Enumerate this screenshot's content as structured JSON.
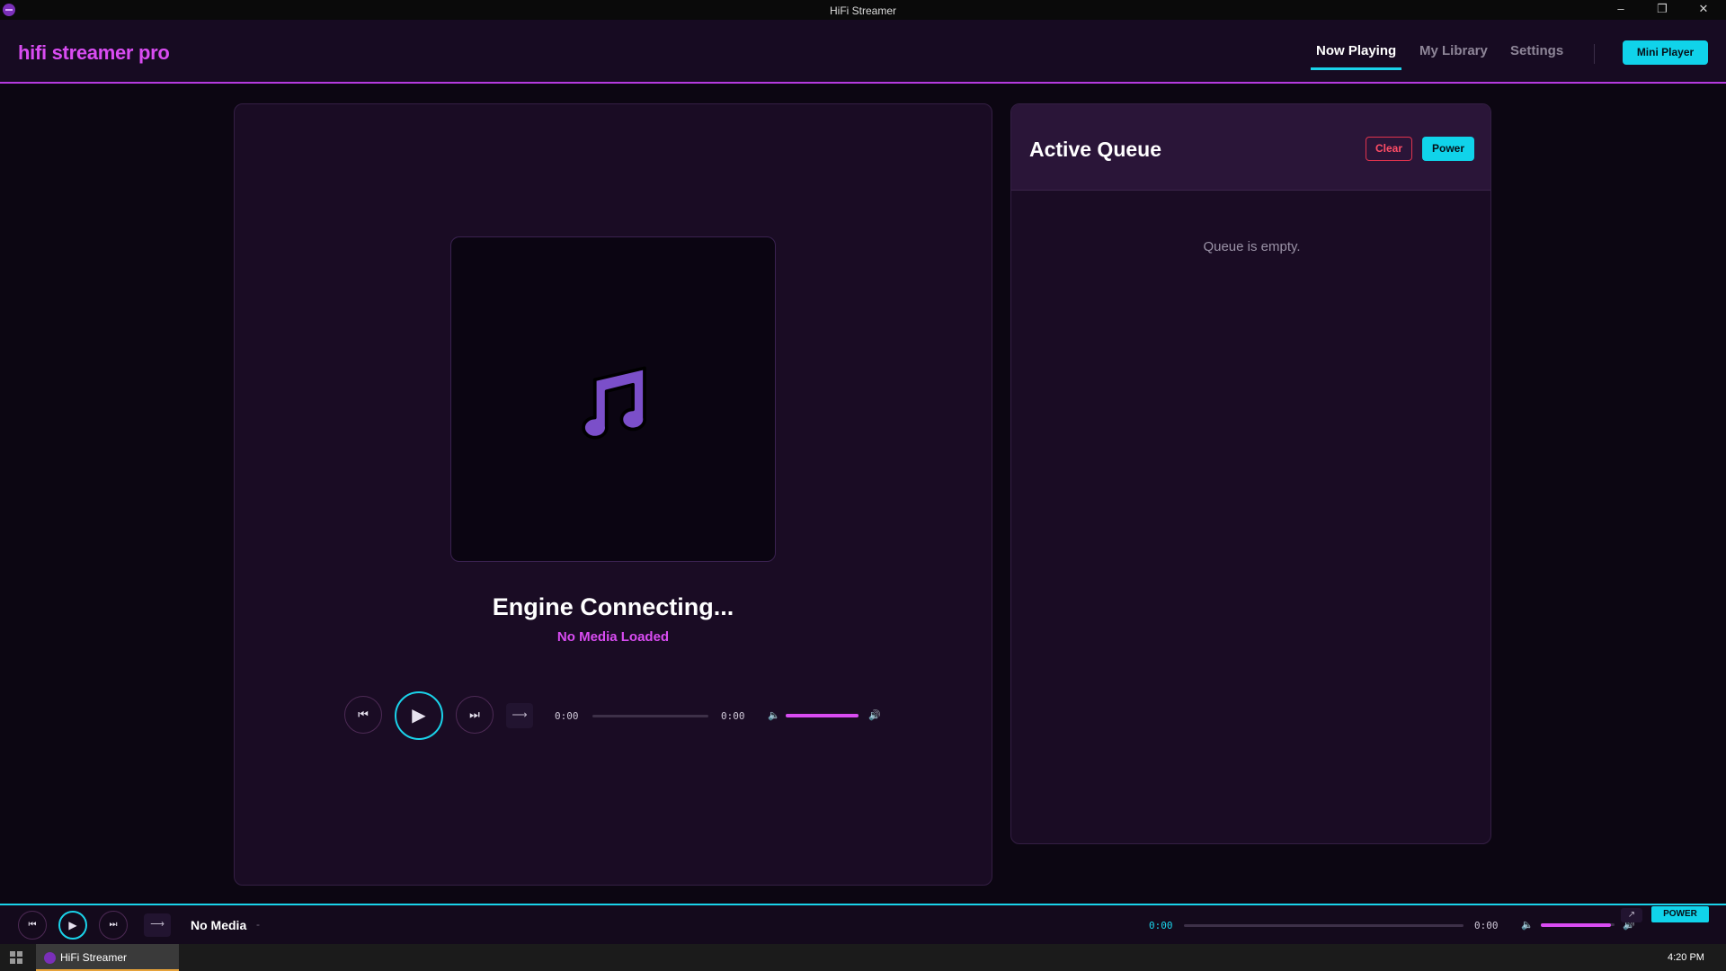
{
  "window": {
    "title": "HiFi Streamer",
    "minimize_glyph": "–",
    "restore_glyph": "❐",
    "close_glyph": "✕"
  },
  "header": {
    "brand": "hifi streamer pro",
    "tabs": [
      {
        "label": "Now Playing",
        "active": true
      },
      {
        "label": "My Library",
        "active": false
      },
      {
        "label": "Settings",
        "active": false
      }
    ],
    "mini_player_label": "Mini Player"
  },
  "now_playing": {
    "title": "Engine Connecting...",
    "subtitle": "No Media Loaded",
    "elapsed": "0:00",
    "duration": "0:00",
    "progress": 0,
    "volume": 1.0,
    "icons": {
      "prev": "skip-previous-icon",
      "play": "play-icon",
      "next": "skip-next-icon",
      "repeat": "repeat-icon",
      "art": "music-note-icon"
    }
  },
  "queue": {
    "title": "Active Queue",
    "clear_label": "Clear",
    "power_label": "Power",
    "empty_text": "Queue is empty."
  },
  "bottom_bar": {
    "title": "No Media",
    "separator": "-",
    "elapsed": "0:00",
    "duration": "0:00",
    "progress": 0,
    "volume": 0.95,
    "power_label": "POWER"
  },
  "taskbar": {
    "app_label": "HiFi Streamer",
    "clock": "4:20 PM"
  },
  "colors": {
    "accent_cyan": "#1ad3ea",
    "accent_magenta": "#d94cf2",
    "danger": "#e0334d",
    "background": "#0c0612",
    "card": "#1a0c24"
  }
}
